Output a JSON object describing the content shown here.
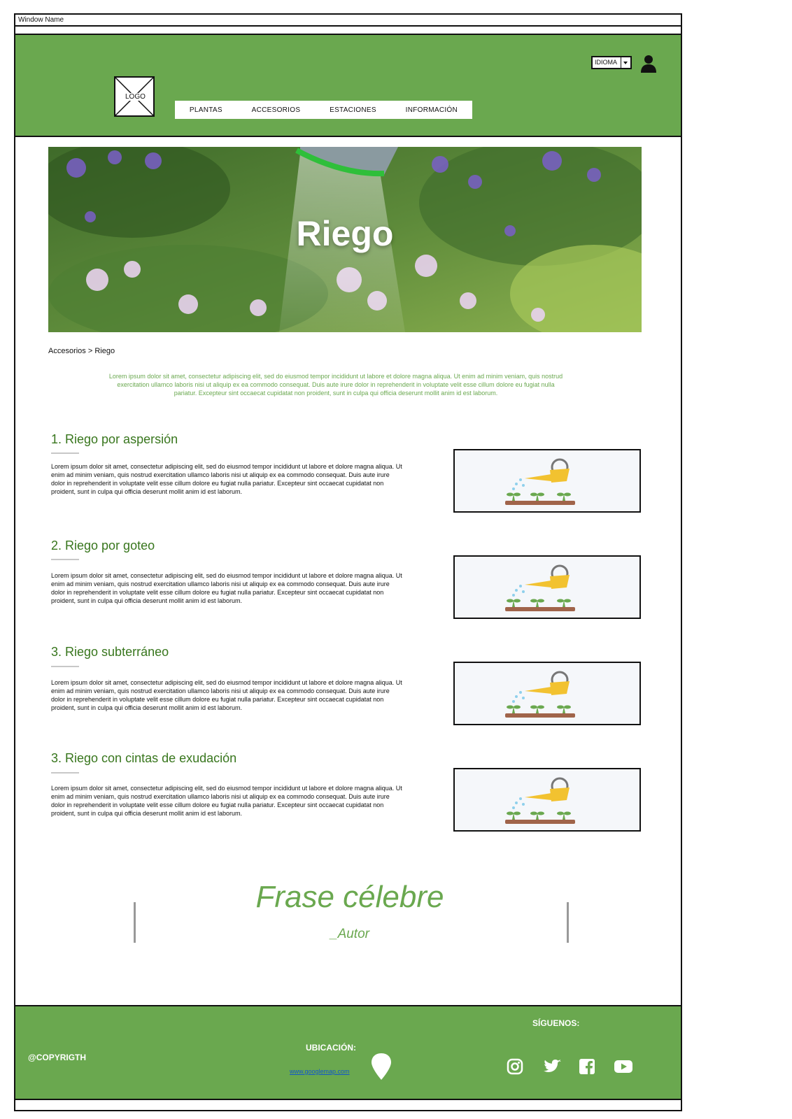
{
  "window": {
    "title": "Window Name"
  },
  "header": {
    "logo_label": "LOGO",
    "nav": [
      "PLANTAS",
      "ACCESORIOS",
      "ESTACIONES",
      "INFORMACIÓN"
    ],
    "language_label": "IDIOMA"
  },
  "hero": {
    "title": "Riego"
  },
  "breadcrumb": "Accesorios > Riego",
  "intro": "Lorem ipsum dolor sit amet, consectetur adipiscing elit, sed do eiusmod tempor incididunt ut labore et dolore magna aliqua. Ut enim ad minim veniam, quis nostrud exercitation ullamco laboris nisi ut aliquip ex ea commodo consequat. Duis aute irure dolor in reprehenderit in voluptate velit esse cillum dolore eu fugiat nulla pariatur. Excepteur sint occaecat cupidatat non proident, sunt in culpa qui officia deserunt mollit anim id est laborum.",
  "sections": [
    {
      "title": "1. Riego por aspersión",
      "text": "Lorem ipsum dolor sit amet, consectetur adipiscing elit, sed do eiusmod tempor incididunt ut labore et dolore magna aliqua. Ut enim ad minim veniam, quis nostrud exercitation ullamco laboris nisi ut aliquip ex ea commodo consequat. Duis aute irure dolor in reprehenderit in voluptate velit esse cillum dolore eu fugiat nulla pariatur. Excepteur sint occaecat cupidatat non proident, sunt in culpa qui officia deserunt mollit anim id est laborum."
    },
    {
      "title": "2. Riego por goteo",
      "text": "Lorem ipsum dolor sit amet, consectetur adipiscing elit, sed do eiusmod tempor incididunt ut labore et dolore magna aliqua. Ut enim ad minim veniam, quis nostrud exercitation ullamco laboris nisi ut aliquip ex ea commodo consequat. Duis aute irure dolor in reprehenderit in voluptate velit esse cillum dolore eu fugiat nulla pariatur. Excepteur sint occaecat cupidatat non proident, sunt in culpa qui officia deserunt mollit anim id est laborum."
    },
    {
      "title": "3. Riego subterráneo",
      "text": "Lorem ipsum dolor sit amet, consectetur adipiscing elit, sed do eiusmod tempor incididunt ut labore et dolore magna aliqua. Ut enim ad minim veniam, quis nostrud exercitation ullamco laboris nisi ut aliquip ex ea commodo consequat. Duis aute irure dolor in reprehenderit in voluptate velit esse cillum dolore eu fugiat nulla pariatur. Excepteur sint occaecat cupidatat non proident, sunt in culpa qui officia deserunt mollit anim id est laborum."
    },
    {
      "title": "3. Riego con cintas de exudación",
      "text": "Lorem ipsum dolor sit amet, consectetur adipiscing elit, sed do eiusmod tempor incididunt ut labore et dolore magna aliqua. Ut enim ad minim veniam, quis nostrud exercitation ullamco laboris nisi ut aliquip ex ea commodo consequat. Duis aute irure dolor in reprehenderit in voluptate velit esse cillum dolore eu fugiat nulla pariatur. Excepteur sint occaecat cupidatat non proident, sunt in culpa qui officia deserunt mollit anim id est laborum."
    }
  ],
  "quote": {
    "text": "Frase célebre",
    "author": "_Autor"
  },
  "footer": {
    "copyright": "@COPYRIGTH",
    "location_label": "UBICACIÓN:",
    "map_link": "www.googlemap.com",
    "follow_label": "SÍGUENOS:",
    "social_icons": [
      "instagram-icon",
      "twitter-icon",
      "facebook-icon",
      "youtube-icon"
    ]
  },
  "colors": {
    "brand_green": "#6aa84f",
    "heading_green": "#38761d"
  }
}
